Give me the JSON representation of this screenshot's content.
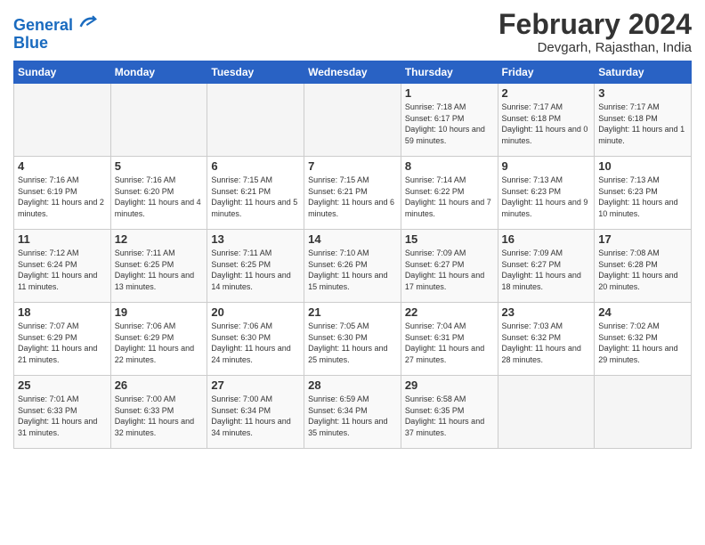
{
  "logo": {
    "line1": "General",
    "line2": "Blue"
  },
  "title": "February 2024",
  "location": "Devgarh, Rajasthan, India",
  "days_of_week": [
    "Sunday",
    "Monday",
    "Tuesday",
    "Wednesday",
    "Thursday",
    "Friday",
    "Saturday"
  ],
  "weeks": [
    [
      {
        "day": "",
        "empty": true
      },
      {
        "day": "",
        "empty": true
      },
      {
        "day": "",
        "empty": true
      },
      {
        "day": "",
        "empty": true
      },
      {
        "day": "1",
        "sunrise": "7:18 AM",
        "sunset": "6:17 PM",
        "daylight": "10 hours and 59 minutes."
      },
      {
        "day": "2",
        "sunrise": "7:17 AM",
        "sunset": "6:18 PM",
        "daylight": "11 hours and 0 minutes."
      },
      {
        "day": "3",
        "sunrise": "7:17 AM",
        "sunset": "6:18 PM",
        "daylight": "11 hours and 1 minute."
      }
    ],
    [
      {
        "day": "4",
        "sunrise": "7:16 AM",
        "sunset": "6:19 PM",
        "daylight": "11 hours and 2 minutes."
      },
      {
        "day": "5",
        "sunrise": "7:16 AM",
        "sunset": "6:20 PM",
        "daylight": "11 hours and 4 minutes."
      },
      {
        "day": "6",
        "sunrise": "7:15 AM",
        "sunset": "6:21 PM",
        "daylight": "11 hours and 5 minutes."
      },
      {
        "day": "7",
        "sunrise": "7:15 AM",
        "sunset": "6:21 PM",
        "daylight": "11 hours and 6 minutes."
      },
      {
        "day": "8",
        "sunrise": "7:14 AM",
        "sunset": "6:22 PM",
        "daylight": "11 hours and 7 minutes."
      },
      {
        "day": "9",
        "sunrise": "7:13 AM",
        "sunset": "6:23 PM",
        "daylight": "11 hours and 9 minutes."
      },
      {
        "day": "10",
        "sunrise": "7:13 AM",
        "sunset": "6:23 PM",
        "daylight": "11 hours and 10 minutes."
      }
    ],
    [
      {
        "day": "11",
        "sunrise": "7:12 AM",
        "sunset": "6:24 PM",
        "daylight": "11 hours and 11 minutes."
      },
      {
        "day": "12",
        "sunrise": "7:11 AM",
        "sunset": "6:25 PM",
        "daylight": "11 hours and 13 minutes."
      },
      {
        "day": "13",
        "sunrise": "7:11 AM",
        "sunset": "6:25 PM",
        "daylight": "11 hours and 14 minutes."
      },
      {
        "day": "14",
        "sunrise": "7:10 AM",
        "sunset": "6:26 PM",
        "daylight": "11 hours and 15 minutes."
      },
      {
        "day": "15",
        "sunrise": "7:09 AM",
        "sunset": "6:27 PM",
        "daylight": "11 hours and 17 minutes."
      },
      {
        "day": "16",
        "sunrise": "7:09 AM",
        "sunset": "6:27 PM",
        "daylight": "11 hours and 18 minutes."
      },
      {
        "day": "17",
        "sunrise": "7:08 AM",
        "sunset": "6:28 PM",
        "daylight": "11 hours and 20 minutes."
      }
    ],
    [
      {
        "day": "18",
        "sunrise": "7:07 AM",
        "sunset": "6:29 PM",
        "daylight": "11 hours and 21 minutes."
      },
      {
        "day": "19",
        "sunrise": "7:06 AM",
        "sunset": "6:29 PM",
        "daylight": "11 hours and 22 minutes."
      },
      {
        "day": "20",
        "sunrise": "7:06 AM",
        "sunset": "6:30 PM",
        "daylight": "11 hours and 24 minutes."
      },
      {
        "day": "21",
        "sunrise": "7:05 AM",
        "sunset": "6:30 PM",
        "daylight": "11 hours and 25 minutes."
      },
      {
        "day": "22",
        "sunrise": "7:04 AM",
        "sunset": "6:31 PM",
        "daylight": "11 hours and 27 minutes."
      },
      {
        "day": "23",
        "sunrise": "7:03 AM",
        "sunset": "6:32 PM",
        "daylight": "11 hours and 28 minutes."
      },
      {
        "day": "24",
        "sunrise": "7:02 AM",
        "sunset": "6:32 PM",
        "daylight": "11 hours and 29 minutes."
      }
    ],
    [
      {
        "day": "25",
        "sunrise": "7:01 AM",
        "sunset": "6:33 PM",
        "daylight": "11 hours and 31 minutes."
      },
      {
        "day": "26",
        "sunrise": "7:00 AM",
        "sunset": "6:33 PM",
        "daylight": "11 hours and 32 minutes."
      },
      {
        "day": "27",
        "sunrise": "7:00 AM",
        "sunset": "6:34 PM",
        "daylight": "11 hours and 34 minutes."
      },
      {
        "day": "28",
        "sunrise": "6:59 AM",
        "sunset": "6:34 PM",
        "daylight": "11 hours and 35 minutes."
      },
      {
        "day": "29",
        "sunrise": "6:58 AM",
        "sunset": "6:35 PM",
        "daylight": "11 hours and 37 minutes."
      },
      {
        "day": "",
        "empty": true
      },
      {
        "day": "",
        "empty": true
      }
    ]
  ],
  "labels": {
    "sunrise": "Sunrise:",
    "sunset": "Sunset:",
    "daylight": "Daylight:"
  }
}
